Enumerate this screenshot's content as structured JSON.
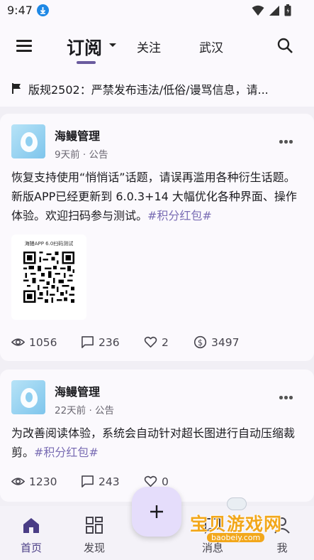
{
  "status_bar": {
    "time": "9:47"
  },
  "header": {
    "tabs": [
      "订阅",
      "关注",
      "武汉"
    ],
    "active_tab": "订阅"
  },
  "notice": {
    "text": "版规2502：严禁发布违法/低俗/谩骂信息，请..."
  },
  "posts": [
    {
      "author": "海鳗管理",
      "meta": "9天前 · 公告",
      "body": "恢复支持使用“悄悄话”话题，请误再滥用各种衍生话题。新版APP已经更新到 6.0.3+14 大幅优化各种界面、操作体验。欢迎扫码参与测试。",
      "tag": "#积分红包#",
      "image_caption": "海鳗APP 6.0扫码测试",
      "views": "1056",
      "comments": "236",
      "likes": "2",
      "coins": "3497"
    },
    {
      "author": "海鳗管理",
      "meta": "22天前 · 公告",
      "body": "为改善阅读体验，系统会自动针对超长图进行自动压缩裁剪。",
      "tag": "#积分红包#",
      "views": "1230",
      "comments": "243",
      "likes": "0"
    }
  ],
  "bottom_nav": [
    {
      "label": "首页",
      "icon": "home-icon",
      "active": true
    },
    {
      "label": "发现",
      "icon": "discover-icon",
      "active": false
    },
    {
      "label": "消息",
      "icon": "message-icon",
      "active": false
    },
    {
      "label": "我",
      "icon": "profile-icon",
      "active": false
    }
  ],
  "watermark": {
    "text": "宝贝游戏网",
    "url": "baobeiy.com"
  },
  "colors": {
    "accent": "#6a5b9e",
    "tag": "#7a6db4",
    "fab": "#e5ddfb",
    "background": "#f1eff5"
  }
}
